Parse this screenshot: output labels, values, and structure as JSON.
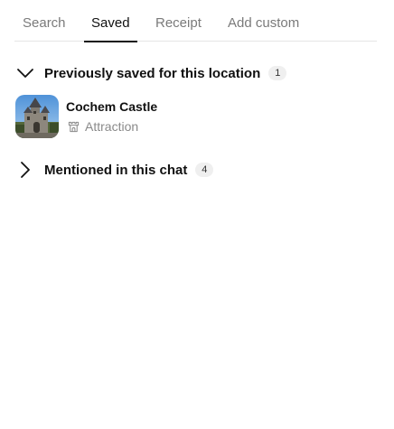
{
  "tabs": [
    {
      "label": "Search",
      "active": false
    },
    {
      "label": "Saved",
      "active": true
    },
    {
      "label": "Receipt",
      "active": false
    },
    {
      "label": "Add custom",
      "active": false
    }
  ],
  "sections": [
    {
      "title": "Previously saved for this location",
      "count": "1",
      "expanded": true,
      "items": [
        {
          "name": "Cochem Castle",
          "type": "Attraction",
          "type_icon": "castle-icon"
        }
      ]
    },
    {
      "title": "Mentioned in this chat",
      "count": "4",
      "expanded": false
    }
  ],
  "colors": {
    "active_tab": "#111111",
    "inactive_tab": "#7a7a7a",
    "badge_bg": "#efefef",
    "muted_text": "#8a8a8a"
  }
}
